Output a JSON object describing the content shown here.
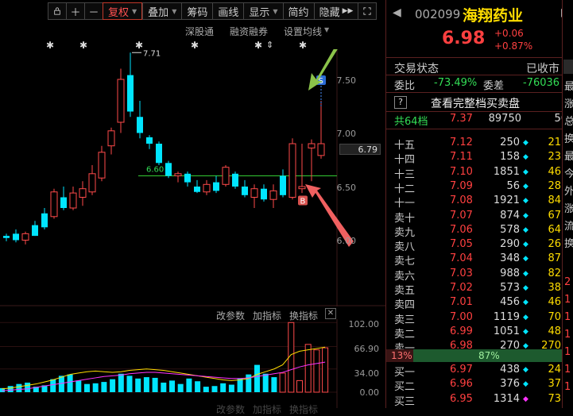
{
  "toolbar": {
    "fuquan": "复权",
    "diejia": "叠加",
    "chouma": "筹码",
    "huaxian": "画线",
    "xianshi": "显示",
    "jianyue": "简约",
    "yincang": "隐藏"
  },
  "subbar": {
    "shengutong": "深股通",
    "rongzi": "融资融券",
    "shezhi": "设置均线"
  },
  "chart": {
    "y_labels": [
      "7.50",
      "7.00",
      "6.50",
      "6.00"
    ],
    "current_price_tag": "6.79",
    "high_annot": "7.71",
    "level_annot": "6.60",
    "sell_marker": "S",
    "buy_marker": "B",
    "candles": [
      {
        "o": 6.04,
        "h": 6.06,
        "l": 5.99,
        "c": 6.02
      },
      {
        "o": 6.06,
        "h": 6.1,
        "l": 5.98,
        "c": 6.0
      },
      {
        "o": 6.0,
        "h": 6.08,
        "l": 5.96,
        "c": 6.06
      },
      {
        "o": 6.14,
        "h": 6.18,
        "l": 6.04,
        "c": 6.04
      },
      {
        "o": 6.25,
        "h": 6.3,
        "l": 6.1,
        "c": 6.12
      },
      {
        "o": 6.22,
        "h": 6.48,
        "l": 6.2,
        "c": 6.45
      },
      {
        "o": 6.4,
        "h": 6.5,
        "l": 6.28,
        "c": 6.3
      },
      {
        "o": 6.3,
        "h": 6.5,
        "l": 6.28,
        "c": 6.44
      },
      {
        "o": 6.4,
        "h": 6.55,
        "l": 6.32,
        "c": 6.48
      },
      {
        "o": 6.45,
        "h": 6.7,
        "l": 6.42,
        "c": 6.62
      },
      {
        "o": 6.58,
        "h": 6.88,
        "l": 6.55,
        "c": 6.82
      },
      {
        "o": 6.88,
        "h": 7.05,
        "l": 6.8,
        "c": 7.02
      },
      {
        "o": 7.1,
        "h": 7.6,
        "l": 7.0,
        "c": 7.5
      },
      {
        "o": 7.54,
        "h": 7.75,
        "l": 7.15,
        "c": 7.2
      },
      {
        "o": 7.15,
        "h": 7.3,
        "l": 6.95,
        "c": 7.0
      },
      {
        "o": 6.96,
        "h": 6.98,
        "l": 6.85,
        "c": 6.9
      },
      {
        "o": 6.9,
        "h": 6.92,
        "l": 6.7,
        "c": 6.72
      },
      {
        "o": 6.72,
        "h": 6.74,
        "l": 6.58,
        "c": 6.6
      },
      {
        "o": 6.6,
        "h": 6.64,
        "l": 6.54,
        "c": 6.62
      },
      {
        "o": 6.62,
        "h": 6.64,
        "l": 6.5,
        "c": 6.54
      },
      {
        "o": 6.5,
        "h": 6.56,
        "l": 6.44,
        "c": 6.45
      },
      {
        "o": 6.45,
        "h": 6.56,
        "l": 6.42,
        "c": 6.52
      },
      {
        "o": 6.54,
        "h": 6.6,
        "l": 6.44,
        "c": 6.46
      },
      {
        "o": 6.52,
        "h": 6.7,
        "l": 6.5,
        "c": 6.68
      },
      {
        "o": 6.62,
        "h": 6.64,
        "l": 6.48,
        "c": 6.5
      },
      {
        "o": 6.5,
        "h": 6.56,
        "l": 6.4,
        "c": 6.42
      },
      {
        "o": 6.4,
        "h": 6.52,
        "l": 6.3,
        "c": 6.48
      },
      {
        "o": 6.48,
        "h": 6.52,
        "l": 6.36,
        "c": 6.38
      },
      {
        "o": 6.38,
        "h": 6.52,
        "l": 6.3,
        "c": 6.46
      },
      {
        "o": 6.6,
        "h": 6.66,
        "l": 6.4,
        "c": 6.42
      },
      {
        "o": 6.4,
        "h": 6.95,
        "l": 6.38,
        "c": 6.9
      },
      {
        "o": 6.48,
        "h": 6.9,
        "l": 6.44,
        "c": 6.5
      },
      {
        "o": 6.86,
        "h": 6.94,
        "l": 6.55,
        "c": 6.9
      },
      {
        "o": 6.79,
        "h": 7.3,
        "l": 6.76,
        "c": 6.9
      }
    ]
  },
  "indicator": {
    "gaicanshu": "改参数",
    "jiazhibiao": "加指标",
    "huanzhibiao": "换指标",
    "y_labels": [
      "102.00",
      "66.90",
      "34.00",
      "0.00"
    ],
    "bars": [
      6,
      9,
      12,
      14,
      8,
      10,
      19,
      24,
      26,
      17,
      12,
      13,
      15,
      19,
      27,
      24,
      20,
      22,
      21,
      14,
      17,
      12,
      20,
      16,
      8,
      9,
      13,
      11,
      20,
      26,
      40,
      27,
      22,
      28,
      102,
      17,
      70,
      62,
      65
    ],
    "line1": [
      5,
      6,
      8,
      10,
      12,
      15,
      18,
      22,
      26,
      28,
      30,
      31,
      30,
      29,
      30,
      32,
      33,
      34,
      33,
      32,
      30,
      28,
      26,
      24,
      22,
      20,
      18,
      17,
      18,
      20,
      26,
      30,
      34,
      40,
      55,
      60,
      62,
      64,
      66
    ],
    "line2": [
      2,
      3,
      4,
      5,
      7,
      9,
      11,
      13,
      15,
      17,
      19,
      21,
      23,
      24,
      25,
      27,
      28,
      29,
      29,
      28,
      27,
      26,
      25,
      24,
      23,
      22,
      21,
      20,
      20,
      21,
      23,
      25,
      27,
      29,
      33,
      37,
      40,
      42,
      44
    ]
  },
  "quote": {
    "code": "002099",
    "name": "海翔药业",
    "price": "6.98",
    "change": "+0.06",
    "change_pct": "+0.87%",
    "status_label": "交易状态",
    "status_value": "已收市",
    "weibi_label": "委比",
    "weibi_value": "-73.49%",
    "weicha_label": "委差",
    "weicha_value": "-76036",
    "help_icon": "?",
    "full_depth": "查看完整档买卖盘",
    "total_levels_label": "共64档",
    "total_levels_price": "7.37",
    "total_levels_vol": "89750",
    "total_levels_cnt": "56",
    "asks": [
      {
        "label": "十五",
        "price": "7.12",
        "vol": "250",
        "dot": "cyan",
        "cnt": "21"
      },
      {
        "label": "十四",
        "price": "7.11",
        "vol": "158",
        "dot": "cyan",
        "cnt": "23"
      },
      {
        "label": "十三",
        "price": "7.10",
        "vol": "1851",
        "dot": "cyan",
        "cnt": "46"
      },
      {
        "label": "十二",
        "price": "7.09",
        "vol": "56",
        "dot": "cyan",
        "cnt": "28"
      },
      {
        "label": "十一",
        "price": "7.08",
        "vol": "1921",
        "dot": "cyan",
        "cnt": "84"
      },
      {
        "label": "卖十",
        "price": "7.07",
        "vol": "874",
        "dot": "cyan",
        "cnt": "67"
      },
      {
        "label": "卖九",
        "price": "7.06",
        "vol": "578",
        "dot": "cyan",
        "cnt": "64"
      },
      {
        "label": "卖八",
        "price": "7.05",
        "vol": "290",
        "dot": "cyan",
        "cnt": "26"
      },
      {
        "label": "卖七",
        "price": "7.04",
        "vol": "348",
        "dot": "cyan",
        "cnt": "87"
      },
      {
        "label": "卖六",
        "price": "7.03",
        "vol": "988",
        "dot": "cyan",
        "cnt": "82"
      },
      {
        "label": "卖五",
        "price": "7.02",
        "vol": "573",
        "dot": "cyan",
        "cnt": "38"
      },
      {
        "label": "卖四",
        "price": "7.01",
        "vol": "456",
        "dot": "cyan",
        "cnt": "46"
      },
      {
        "label": "卖三",
        "price": "7.00",
        "vol": "1119",
        "dot": "cyan",
        "cnt": "70"
      },
      {
        "label": "卖二",
        "price": "6.99",
        "vol": "1051",
        "dot": "cyan",
        "cnt": "48"
      },
      {
        "label": "卖一",
        "price": "6.98",
        "vol": "270",
        "dot": "cyan",
        "cnt": "270"
      }
    ],
    "ratio_left": "13%",
    "ratio_right": "87%",
    "bids": [
      {
        "label": "买一",
        "price": "6.97",
        "vol": "438",
        "dot": "cyan",
        "cnt": "24"
      },
      {
        "label": "买二",
        "price": "6.96",
        "vol": "376",
        "dot": "cyan",
        "cnt": "37"
      },
      {
        "label": "买三",
        "price": "6.95",
        "vol": "1314",
        "dot": "magenta",
        "cnt": "73"
      }
    ],
    "side_chars": [
      "最",
      "涨",
      "总",
      "换",
      "最",
      "今",
      "外",
      "涨",
      "流",
      "换"
    ],
    "side_nums": [
      "2",
      "1",
      "1",
      "1",
      "1",
      "1",
      "1"
    ]
  }
}
